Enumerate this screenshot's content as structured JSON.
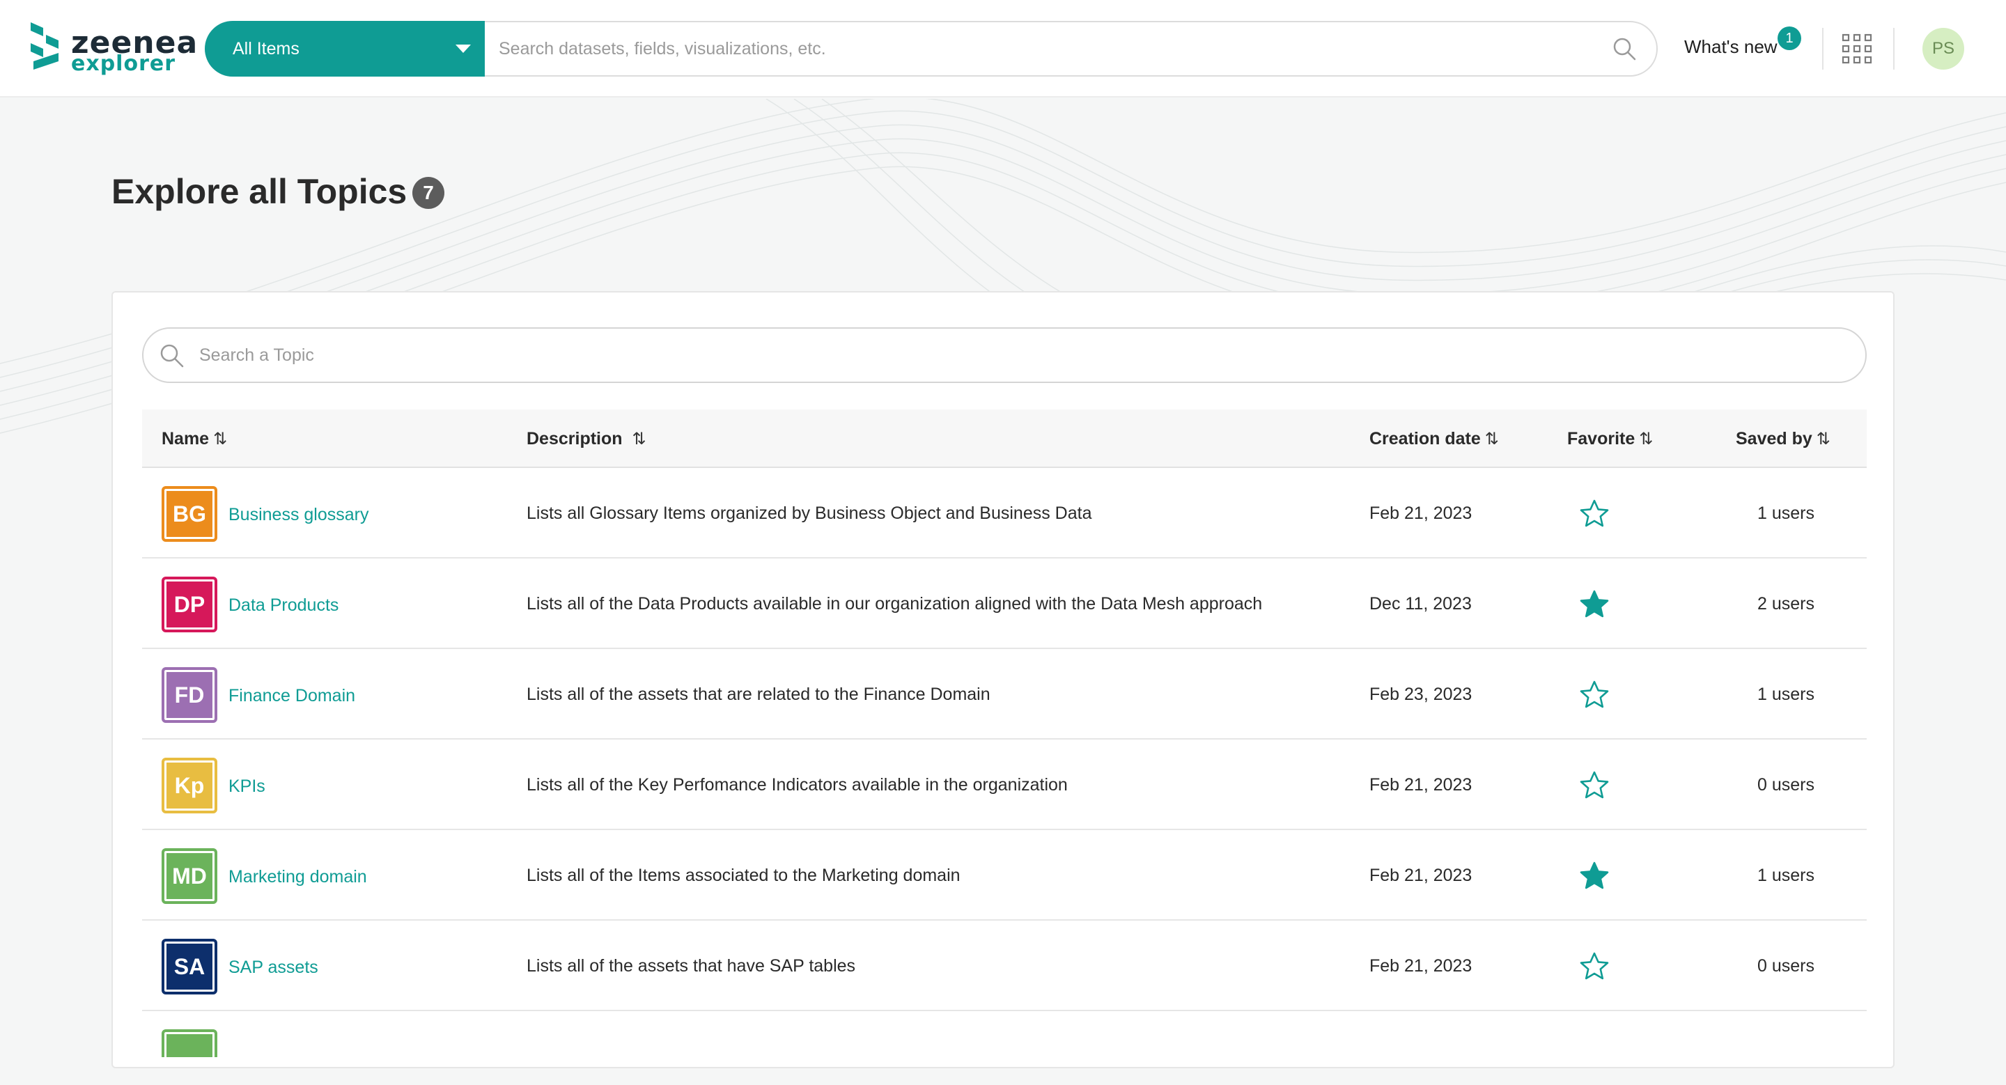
{
  "app": {
    "logo_primary": "zeenea",
    "logo_secondary": "explorer",
    "brand_color": "#0f9c94"
  },
  "header": {
    "scope_label": "All Items",
    "search_placeholder": "Search datasets, fields, visualizations, etc.",
    "whats_new_label": "What's new",
    "whats_new_count": "1",
    "user_initials": "PS",
    "icons": [
      "search-icon",
      "apps-grid-icon",
      "chevron-down-icon"
    ]
  },
  "page": {
    "title": "Explore all Topics",
    "topic_count": "7"
  },
  "topic_search": {
    "placeholder": "Search a Topic"
  },
  "table": {
    "columns": {
      "name": "Name",
      "description": "Description",
      "creation_date": "Creation date",
      "favorite": "Favorite",
      "saved_by": "Saved by"
    },
    "sort_glyph": "⇅",
    "rows": [
      {
        "initials": "BG",
        "name": "Business glossary",
        "description": "Lists all Glossary Items organized by Business Object and Business Data",
        "date": "Feb 21, 2023",
        "favorite": false,
        "saved_by": "1 users",
        "color": "#ec8c1c"
      },
      {
        "initials": "DP",
        "name": "Data Products",
        "description": "Lists all of the Data Products available in our organization aligned with the Data Mesh approach",
        "date": "Dec 11, 2023",
        "favorite": true,
        "saved_by": "2 users",
        "color": "#d6185a"
      },
      {
        "initials": "FD",
        "name": "Finance Domain",
        "description": "Lists all of the assets that are related to the Finance Domain",
        "date": "Feb 23, 2023",
        "favorite": false,
        "saved_by": "1 users",
        "color": "#9c6fb2"
      },
      {
        "initials": "Kp",
        "name": "KPIs",
        "description": "Lists all of the Key Perfomance Indicators available in the organization",
        "date": "Feb 21, 2023",
        "favorite": false,
        "saved_by": "0 users",
        "color": "#e8bd41"
      },
      {
        "initials": "MD",
        "name": "Marketing domain",
        "description": "Lists all of the Items associated to the Marketing domain",
        "date": "Feb 21, 2023",
        "favorite": true,
        "saved_by": "1 users",
        "color": "#6bb35b"
      },
      {
        "initials": "SA",
        "name": "SAP assets",
        "description": "Lists all of the assets that have SAP tables",
        "date": "Feb 21, 2023",
        "favorite": false,
        "saved_by": "0 users",
        "color": "#0d2f6c"
      },
      {
        "initials": "",
        "name": "",
        "description": "",
        "date": "",
        "favorite": false,
        "saved_by": "",
        "color": "#6bb35b"
      }
    ]
  }
}
